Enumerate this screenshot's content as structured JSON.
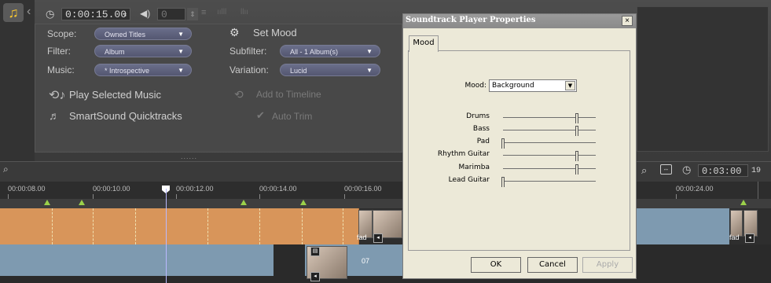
{
  "top": {
    "time": "0:00:15.00",
    "volume": "0",
    "scope_label": "Scope:",
    "scope_value": "Owned Titles",
    "filter_label": "Filter:",
    "filter_value": "Album",
    "music_label": "Music:",
    "music_value": "* Introspective",
    "set_mood": "Set Mood",
    "subfilter_label": "Subfilter:",
    "subfilter_value": "All - 1 Album(s)",
    "variation_label": "Variation:",
    "variation_value": "Lucid",
    "play_selected": "Play Selected Music",
    "quicktracks": "SmartSound Quicktracks",
    "add_to_timeline": "Add to Timeline",
    "auto_trim": "Auto Trim"
  },
  "timeline": {
    "ruler_labels": [
      "00:00:08.00",
      "00:00:10.00",
      "00:00:12.00",
      "00:00:14.00",
      "00:00:16.00",
      "00:00:24.00"
    ],
    "duration": "0:03:00",
    "duration_frames": "19",
    "clip_label_fade": "fad",
    "clip_label_07": "07"
  },
  "dialog": {
    "title": "Soundtrack Player Properties",
    "close": "×",
    "tab": "Mood",
    "mood_label": "Mood:",
    "mood_value": "Background",
    "sliders": [
      {
        "label": "Drums",
        "value": 0.8
      },
      {
        "label": "Bass",
        "value": 0.8
      },
      {
        "label": "Pad",
        "value": 0.0
      },
      {
        "label": "Rhythm Guitar",
        "value": 0.8
      },
      {
        "label": "Marimba",
        "value": 0.8
      },
      {
        "label": "Lead Guitar",
        "value": 0.0
      }
    ],
    "ok": "OK",
    "cancel": "Cancel",
    "apply": "Apply"
  }
}
